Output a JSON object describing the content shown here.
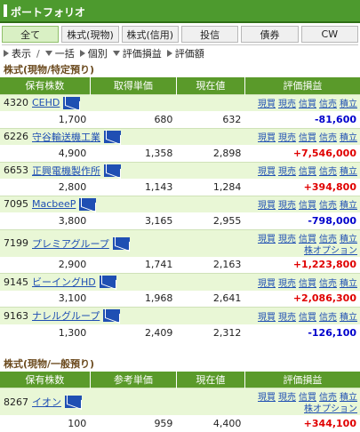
{
  "header": {
    "title": "ポートフォリオ"
  },
  "tabs": [
    "全て",
    "株式(現物)",
    "株式(信用)",
    "投信",
    "債券",
    "CW"
  ],
  "filters": {
    "display": "表示",
    "sep": "/",
    "expand_all": "一括",
    "individual": "個別",
    "eval_pl": "評価損益",
    "eval_amount": "評価額"
  },
  "section1": {
    "title": "株式(現物/特定預り)",
    "cols": [
      "保有株数",
      "取得単価",
      "現在値",
      "評価損益"
    ],
    "rows": [
      {
        "code": "4320",
        "name": "CEHD",
        "qty": "1,700",
        "cost": "680",
        "price": "632",
        "pl": "-81,600",
        "sign": "neg",
        "opt": false
      },
      {
        "code": "6226",
        "name": "守谷輸送機工業",
        "qty": "4,900",
        "cost": "1,358",
        "price": "2,898",
        "pl": "+7,546,000",
        "sign": "pos",
        "opt": false
      },
      {
        "code": "6653",
        "name": "正興電機製作所",
        "qty": "2,800",
        "cost": "1,143",
        "price": "1,284",
        "pl": "+394,800",
        "sign": "pos",
        "opt": false
      },
      {
        "code": "7095",
        "name": "MacbeeP",
        "qty": "3,800",
        "cost": "3,165",
        "price": "2,955",
        "pl": "-798,000",
        "sign": "neg",
        "opt": false
      },
      {
        "code": "7199",
        "name": "プレミアグループ",
        "qty": "2,900",
        "cost": "1,741",
        "price": "2,163",
        "pl": "+1,223,800",
        "sign": "pos",
        "opt": true
      },
      {
        "code": "9145",
        "name": "ビーイングHD",
        "qty": "3,100",
        "cost": "1,968",
        "price": "2,641",
        "pl": "+2,086,300",
        "sign": "pos",
        "opt": false
      },
      {
        "code": "9163",
        "name": "ナレルグループ",
        "qty": "1,300",
        "cost": "2,409",
        "price": "2,312",
        "pl": "-126,100",
        "sign": "neg",
        "opt": false
      }
    ]
  },
  "section2": {
    "title": "株式(現物/一般預り)",
    "cols": [
      "保有株数",
      "参考単価",
      "現在値",
      "評価損益"
    ],
    "rows": [
      {
        "code": "8267",
        "name": "イオン",
        "qty": "100",
        "cost": "959",
        "price": "4,400",
        "pl": "+344,100",
        "sign": "pos",
        "opt": true
      }
    ]
  },
  "actions": {
    "a": "現買",
    "b": "現売",
    "c": "信買",
    "d": "信売",
    "e": "積立",
    "opt": "株オプション"
  }
}
